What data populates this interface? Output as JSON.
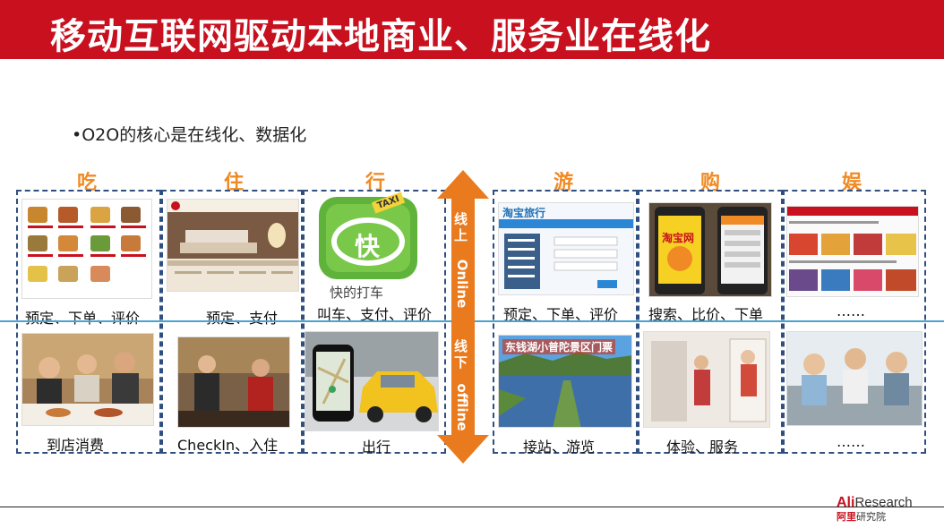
{
  "header": {
    "title": "移动互联网驱动本地商业、服务业在线化"
  },
  "bullet": "•O2O的核心是在线化、数据化",
  "categories": [
    "吃",
    "住",
    "行",
    "游",
    "购",
    "娱"
  ],
  "online_captions": [
    "预定、下单、评价",
    "预定、支付",
    "叫车、支付、评价",
    "预定、下单、评价",
    "搜索、比价、下单",
    "……"
  ],
  "offline_captions": [
    "到店消费",
    "CheckIn、入住",
    "出行",
    "接站、游览",
    "体验、服务",
    "……"
  ],
  "image_text": {
    "taxi_badge": "TAXI",
    "taxi_glyph": "快",
    "taxi_app_name": "快的打车",
    "travel_site": "淘宝旅行",
    "shopping_site": "淘宝网",
    "scenic_banner": "东钱湖小普陀景区门票"
  },
  "arrow": {
    "online_cn": "线上",
    "online_en": "Online",
    "offline_cn": "线下",
    "offline_en": "offline"
  },
  "footer": {
    "logo_ali": "Ali",
    "logo_research": "Research",
    "logo_cn_red": "阿里",
    "logo_cn": "研究院"
  },
  "colors": {
    "title_bg": "#c8101e",
    "category": "#f08a24",
    "arrow": "#ea7a1e",
    "divider": "#4aa3d0",
    "dash": "#2f4f80"
  }
}
